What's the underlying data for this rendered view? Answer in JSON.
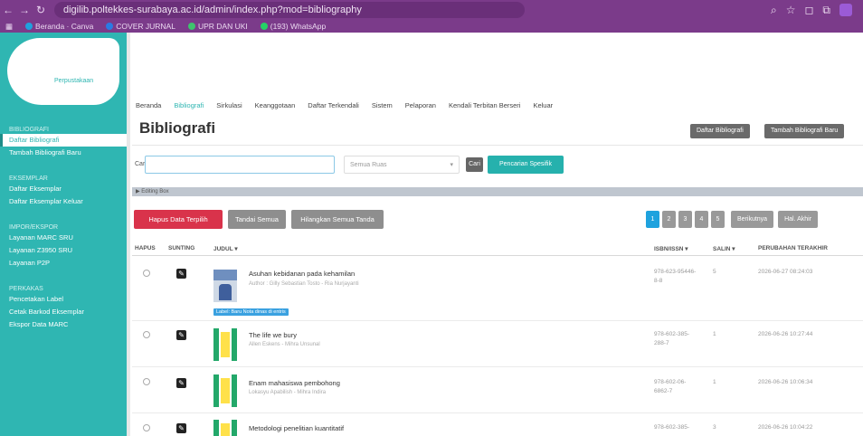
{
  "browser": {
    "url": "digilib.poltekkes-surabaya.ac.id/admin/index.php?mod=bibliography",
    "bookmarks": [
      "Beranda · Canva",
      "COVER JURNAL",
      "UPR DAN UKI",
      "(193) WhatsApp"
    ]
  },
  "sidebar": {
    "logo_text": "Perpustakaan",
    "sections": [
      {
        "head": "BIBLIOGRAFI",
        "items": [
          "Daftar Bibliografi",
          "Tambah Bibliografi Baru"
        ]
      },
      {
        "head": "EKSEMPLAR",
        "items": [
          "Daftar Eksemplar",
          "Daftar Eksemplar Keluar"
        ]
      },
      {
        "head": "IMPOR/EKSPOR",
        "items": [
          "Layanan MARC SRU",
          "Layanan Z3950 SRU",
          "Layanan P2P"
        ]
      },
      {
        "head": "PERKAKAS",
        "items": [
          "Pencetakan Label",
          "Cetak Barkod Eksemplar",
          "Ekspor Data MARC"
        ]
      }
    ]
  },
  "topmenu": [
    "Beranda",
    "Bibliografi",
    "Sirkulasi",
    "Keanggotaan",
    "Daftar Terkendali",
    "Sistem",
    "Pelaporan",
    "Kendali Terbitan Berseri",
    "Keluar"
  ],
  "page": {
    "title": "Bibliografi",
    "btn_list": "Daftar Bibliografi",
    "btn_add": "Tambah Bibliografi Baru"
  },
  "search": {
    "label": "Cari",
    "value": "",
    "select_value": "Semua Ruas",
    "btn_search": "Cari",
    "btn_advanced": "Pencarian Spesifik"
  },
  "editbar_label": "▶ Editing Box",
  "actions": {
    "delete_selected": "Hapus Data Terpilih",
    "select_all": "Tandai Semua",
    "unselect_all": "Hilangkan Semua Tanda"
  },
  "pagination": {
    "pages": [
      "1",
      "2",
      "3",
      "4",
      "5"
    ],
    "next": "Berikutnya",
    "last": "Hal. Akhir"
  },
  "table": {
    "headers": [
      "HAPUS",
      "SUNTING",
      "JUDUL ▾",
      "ISBN/ISSN ▾",
      "SALIN ▾",
      "PERUBAHAN TERAKHIR"
    ],
    "rows": [
      {
        "title": "Asuhan kebidanan pada kehamilan",
        "author": "Author : Gilly Sebastian Tosto - Ria Nurjayanti",
        "isbn": "978-623-95446-8-8",
        "copies": "5",
        "updated": "2026-06-27 08:24:03",
        "badge": "Label: Baru Nota dinas di entris"
      },
      {
        "title": "The life we bury",
        "author": "Allen Eskens - Mihra Unsunal",
        "isbn": "978-602-385-288-7",
        "copies": "1",
        "updated": "2026-06-26 10:27:44",
        "badge": ""
      },
      {
        "title": "Enam mahasiswa pembohong",
        "author": "Lokasyu Apabilish - Mihra Indira",
        "isbn": "978-602-06-6862-7",
        "copies": "1",
        "updated": "2026-06-26 10:06:34",
        "badge": ""
      },
      {
        "title": "Metodologi penelitian kuantitatif",
        "author": "",
        "isbn": "978-602-385-",
        "copies": "3",
        "updated": "2026-06-26 10:04:22",
        "badge": ""
      }
    ]
  },
  "colors": {
    "primary": "#2fb6b2",
    "danger": "#d9334b",
    "browser": "#7b3b8a",
    "pager_current": "#1fa2de"
  }
}
